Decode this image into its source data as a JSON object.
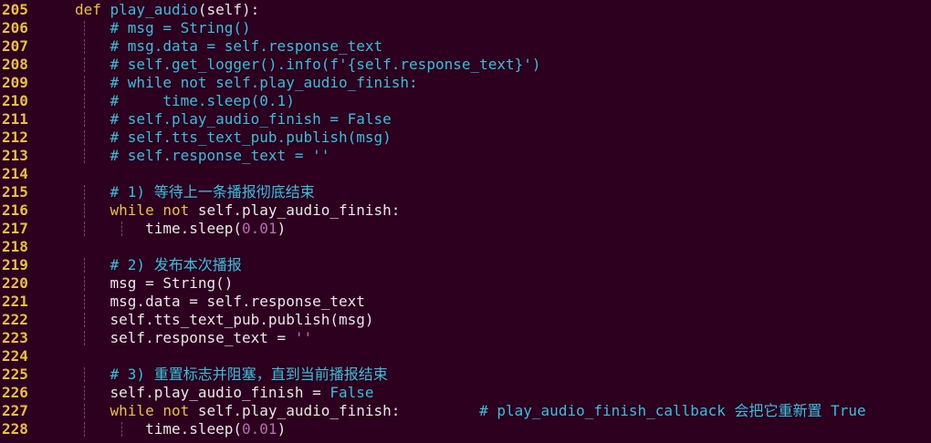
{
  "editor": {
    "lines": [
      {
        "n": "205",
        "g": 0,
        "t": [
          [
            "kw",
            "def "
          ],
          [
            "fn",
            "play_audio"
          ],
          [
            "tx",
            "(self):"
          ]
        ]
      },
      {
        "n": "206",
        "g": 1,
        "t": [
          [
            "cm",
            "    # msg = String()"
          ]
        ]
      },
      {
        "n": "207",
        "g": 1,
        "t": [
          [
            "cm",
            "    # msg.data = self.response_text"
          ]
        ]
      },
      {
        "n": "208",
        "g": 1,
        "t": [
          [
            "cm",
            "    # self.get_logger().info(f'{self.response_text}')"
          ]
        ]
      },
      {
        "n": "209",
        "g": 1,
        "t": [
          [
            "cm",
            "    # while not self.play_audio_finish:"
          ]
        ]
      },
      {
        "n": "210",
        "g": 1,
        "t": [
          [
            "cm",
            "    #     time.sleep(0.1)"
          ]
        ]
      },
      {
        "n": "211",
        "g": 1,
        "t": [
          [
            "cm",
            "    # self.play_audio_finish = False"
          ]
        ]
      },
      {
        "n": "212",
        "g": 1,
        "t": [
          [
            "cm",
            "    # self.tts_text_pub.publish(msg)"
          ]
        ]
      },
      {
        "n": "213",
        "g": 1,
        "t": [
          [
            "cm",
            "    # self.response_text = ''"
          ]
        ]
      },
      {
        "n": "214",
        "g": 0,
        "t": []
      },
      {
        "n": "215",
        "g": 1,
        "t": [
          [
            "cm",
            "    # 1) 等待上一条播报彻底结束"
          ]
        ]
      },
      {
        "n": "216",
        "g": 1,
        "t": [
          [
            "tx",
            "    "
          ],
          [
            "kw",
            "while not "
          ],
          [
            "tx",
            "self.play_audio_finish:"
          ]
        ]
      },
      {
        "n": "217",
        "g": 2,
        "t": [
          [
            "tx",
            "        time.sleep("
          ],
          [
            "num",
            "0.01"
          ],
          [
            "tx",
            ")"
          ]
        ]
      },
      {
        "n": "218",
        "g": 0,
        "t": []
      },
      {
        "n": "219",
        "g": 1,
        "t": [
          [
            "cm",
            "    # 2) 发布本次播报"
          ]
        ]
      },
      {
        "n": "220",
        "g": 1,
        "t": [
          [
            "tx",
            "    msg = String()"
          ]
        ]
      },
      {
        "n": "221",
        "g": 1,
        "t": [
          [
            "tx",
            "    msg.data = self.response_text"
          ]
        ]
      },
      {
        "n": "222",
        "g": 1,
        "t": [
          [
            "tx",
            "    self.tts_text_pub.publish(msg)"
          ]
        ]
      },
      {
        "n": "223",
        "g": 1,
        "t": [
          [
            "tx",
            "    self.response_text = "
          ],
          [
            "str",
            "''"
          ]
        ]
      },
      {
        "n": "224",
        "g": 0,
        "t": []
      },
      {
        "n": "225",
        "g": 1,
        "t": [
          [
            "cm",
            "    # 3) 重置标志并阻塞，直到当前播报结束"
          ]
        ]
      },
      {
        "n": "226",
        "g": 1,
        "t": [
          [
            "tx",
            "    self.play_audio_finish = "
          ],
          [
            "bool",
            "False"
          ]
        ]
      },
      {
        "n": "227",
        "g": 1,
        "t": [
          [
            "tx",
            "    "
          ],
          [
            "kw",
            "while not "
          ],
          [
            "tx",
            "self.play_audio_finish:"
          ],
          [
            "cm",
            "         # play_audio_finish_callback 会把它重新置 True"
          ]
        ]
      },
      {
        "n": "228",
        "g": 2,
        "t": [
          [
            "tx",
            "        time.sleep("
          ],
          [
            "num",
            "0.01"
          ],
          [
            "tx",
            ")"
          ]
        ]
      }
    ]
  }
}
